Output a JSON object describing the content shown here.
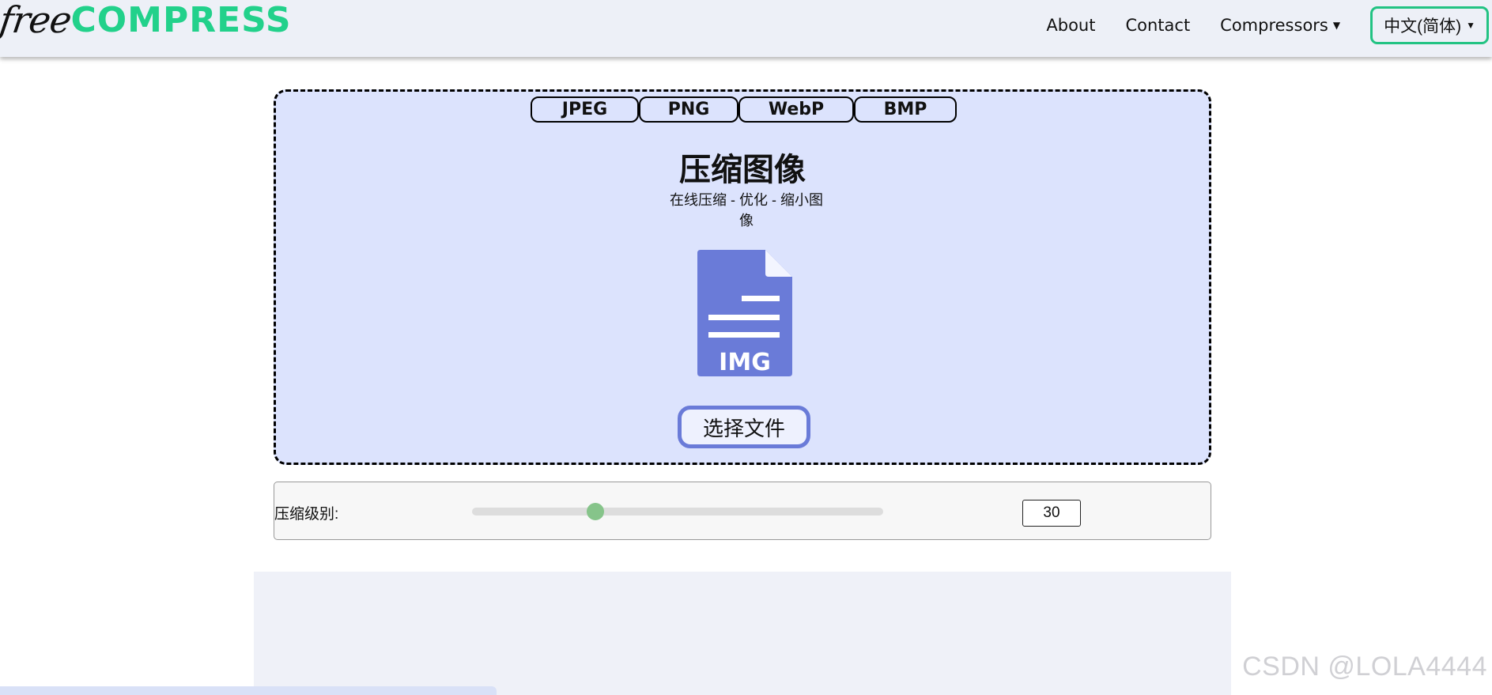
{
  "header": {
    "logo_free": "free",
    "logo_compress": "COMPRESS",
    "nav": {
      "about": "About",
      "contact": "Contact",
      "compressors": "Compressors",
      "language": "中文(简体)"
    }
  },
  "dropzone": {
    "tabs": [
      "JPEG",
      "PNG",
      "WebP",
      "BMP"
    ],
    "title": "压缩图像",
    "subtitle": "在线压缩 - 优化 - 缩小图像",
    "file_icon_label": "IMG",
    "choose_button": "选择文件"
  },
  "level": {
    "label": "压缩级别:",
    "value": "30",
    "slider_fraction": 0.3
  },
  "watermark": "CSDN @LOLA4444",
  "colors": {
    "accent_green": "#22d18b",
    "dropzone_bg": "#dce3fd",
    "icon_blue": "#6a7bd8",
    "slider_thumb": "#86c48a"
  },
  "icons": {
    "caret": "caret-down-icon",
    "file": "image-file-icon"
  }
}
